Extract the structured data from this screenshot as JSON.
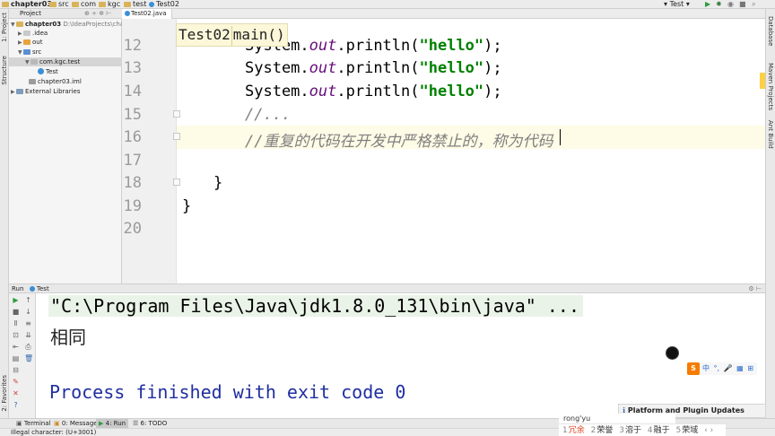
{
  "navbar": {
    "crumbs": [
      "chapter03",
      "src",
      "com",
      "kgc",
      "test",
      "Test02"
    ],
    "run_config": "Test"
  },
  "left_strip": {
    "project_label": "1: Project",
    "structure_label": "Structure",
    "favorites_label": "2: Favorites"
  },
  "right_strip": {
    "database_label": "Database",
    "maven_label": "Maven Projects",
    "ant_label": "Ant Build"
  },
  "project": {
    "header": "Project",
    "tree": [
      {
        "label": "chapter03",
        "extra": "D:\\IdeaProjects\\chap"
      },
      {
        "label": ".idea"
      },
      {
        "label": "out"
      },
      {
        "label": "src"
      },
      {
        "label": "com.kgc.test"
      },
      {
        "label": "Test"
      },
      {
        "label": "chapter03.iml"
      },
      {
        "label": "External Libraries"
      }
    ]
  },
  "editor": {
    "tab": "Test02.java",
    "breadcrumb_class": "Test02",
    "breadcrumb_method": "main()",
    "lines": [
      {
        "num": "12",
        "pre": "System.",
        "method": "out",
        "mid": ".println(",
        "str": "\"hello\"",
        "post": ");"
      },
      {
        "num": "13",
        "pre": "System.",
        "method": "out",
        "mid": ".println(",
        "str": "\"hello\"",
        "post": ");"
      },
      {
        "num": "14",
        "pre": "System.",
        "method": "out",
        "mid": ".println(",
        "str": "\"hello\"",
        "post": ");"
      },
      {
        "num": "15",
        "comment": "//..."
      },
      {
        "num": "16",
        "comment": "//重复的代码在开发中严格禁止的，称为代码"
      },
      {
        "num": "17"
      },
      {
        "num": "18",
        "brace": "}"
      },
      {
        "num": "19",
        "brace": "}"
      },
      {
        "num": "20"
      }
    ]
  },
  "run": {
    "header": "Run",
    "config": "Test",
    "cmd": "\"C:\\Program Files\\Java\\jdk1.8.0_131\\bin\\java\" ...",
    "output": "相同",
    "exit": "Process finished with exit code 0"
  },
  "bottom_tabs": {
    "terminal": "Terminal",
    "messages": "0: Messages",
    "run": "4: Run",
    "todo": "6: TODO"
  },
  "status": "Illegal character: (U+3001)",
  "notification": "Platform and Plugin Updates",
  "ime": {
    "composition": "rong'yu",
    "candidates": [
      {
        "n": "1",
        "w": "冗余"
      },
      {
        "n": "2",
        "w": "荣誉"
      },
      {
        "n": "3",
        "w": "溶于"
      },
      {
        "n": "4",
        "w": "融于"
      },
      {
        "n": "5",
        "w": "荣域"
      }
    ],
    "toolbar_label": "中"
  },
  "colors": {
    "current_line": "#fefbe6",
    "string": "#008000",
    "comment": "#808080",
    "field": "#660e7a"
  }
}
